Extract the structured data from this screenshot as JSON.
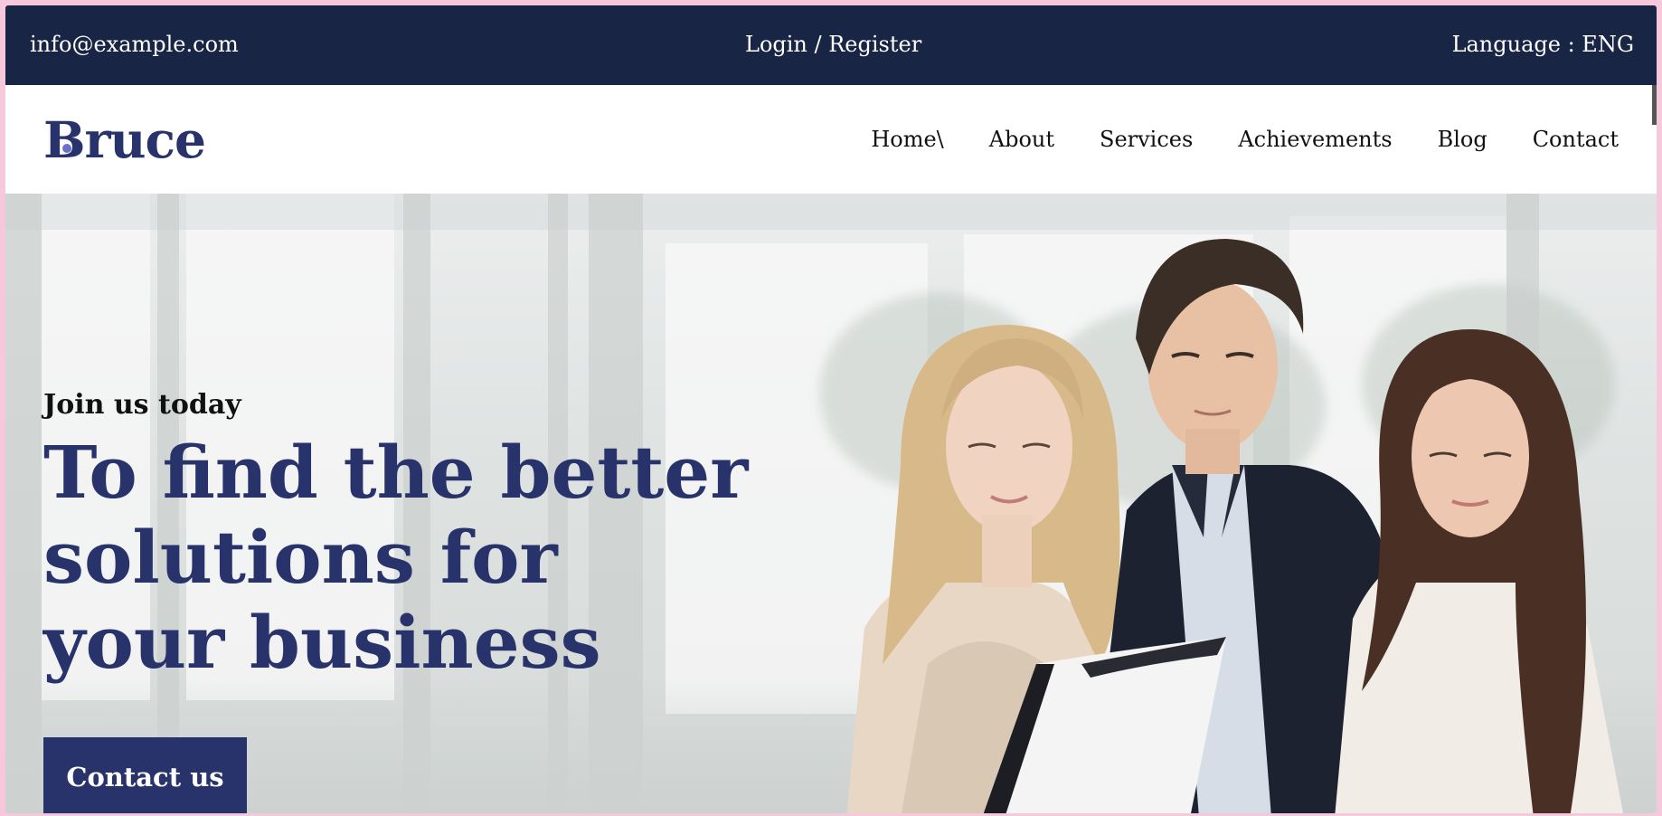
{
  "topbar": {
    "email": "info@example.com",
    "login": "Login / Register",
    "language": "Language : ENG"
  },
  "brand": {
    "name": "Bruce"
  },
  "nav": {
    "items": [
      "Home\\",
      "About",
      "Services",
      "Achievements",
      "Blog",
      "Contact"
    ]
  },
  "hero": {
    "tagline": "Join us today",
    "headline": "To find the better solutions for your business",
    "cta": "Contact us"
  },
  "colors": {
    "topbar": "#182544",
    "brand": "#27336a",
    "page_border": "#f6c8dc"
  }
}
